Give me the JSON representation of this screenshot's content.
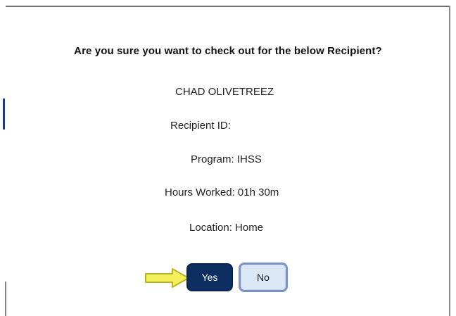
{
  "dialog": {
    "question": "Are you sure you want to check out for the below Recipient?",
    "recipient_name": "CHAD OLIVETREEZ",
    "recipient_id_label": "Recipient ID:",
    "program": "Program: IHSS",
    "hours_worked": "Hours Worked: 01h 30m",
    "location": "Location: Home",
    "yes_label": "Yes",
    "no_label": "No"
  },
  "icons": {
    "pointer": "arrow-right-icon"
  },
  "colors": {
    "yes_button_bg": "#0e2e62",
    "no_button_bg": "#dbe9f7",
    "no_button_border": "#7b93c7",
    "arrow_fill": "#f4f05a",
    "arrow_stroke": "#b9b32a"
  }
}
